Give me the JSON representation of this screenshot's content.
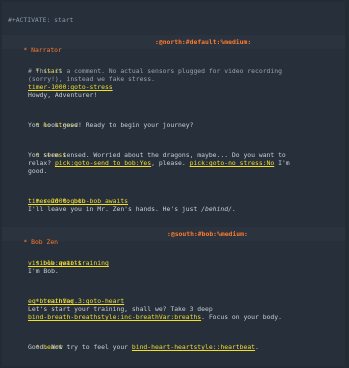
{
  "header": {
    "activate": "#+ACTIVATE: start"
  },
  "sections": [
    {
      "title": "Narrator",
      "tag": ":@north:#default:%medium:",
      "items": [
        {
          "title": "start",
          "comment1": "# This is a comment. No actual sensors plugged for video recording",
          "comment2": "(sorry!), instead we fake stress.",
          "link": "timer-1000:goto-stress",
          "text": "Howdy, Adventurer!"
        },
        {
          "title": "no stress",
          "text": "You look good! Ready to begin your journey?"
        },
        {
          "title": "stress",
          "line1": "You seem tensed. Worried about the dragons, maybe... Do you want to",
          "line2_a": "relax? ",
          "line2_link1": "pick:goto-send to bob:Yes",
          "line2_b": ", please. ",
          "line2_link2": "pick:goto-no stress:No",
          "line2_c": " I'm",
          "line3": "good."
        },
        {
          "title": "send to bob",
          "link": "timer-2000:goto-bob awaits",
          "text_a": "I'll leave you in Mr. Zen's hands. He's just ",
          "text_it": "/behind/",
          "text_b": "."
        }
      ]
    },
    {
      "title": "Bob Zen",
      "tag": ":@south:#bob:%medium:",
      "items": [
        {
          "title": "bob awaits",
          "link": "visible:goto-training",
          "text": "I'm Bob."
        },
        {
          "title": "training",
          "link": "eq-breathVar.3:goto-heart",
          "text1": "Let's start your training, shall we? Take 3 deep",
          "link2": "bind-breath-breathstyle:inc-breathVar:breaths",
          "text2": ". Focus on your body."
        },
        {
          "title": "heart",
          "text_a": "Good. Now try to feel your ",
          "link": "bind-heart-heartstyle::heartbeat",
          "text_b": "."
        }
      ]
    }
  ]
}
